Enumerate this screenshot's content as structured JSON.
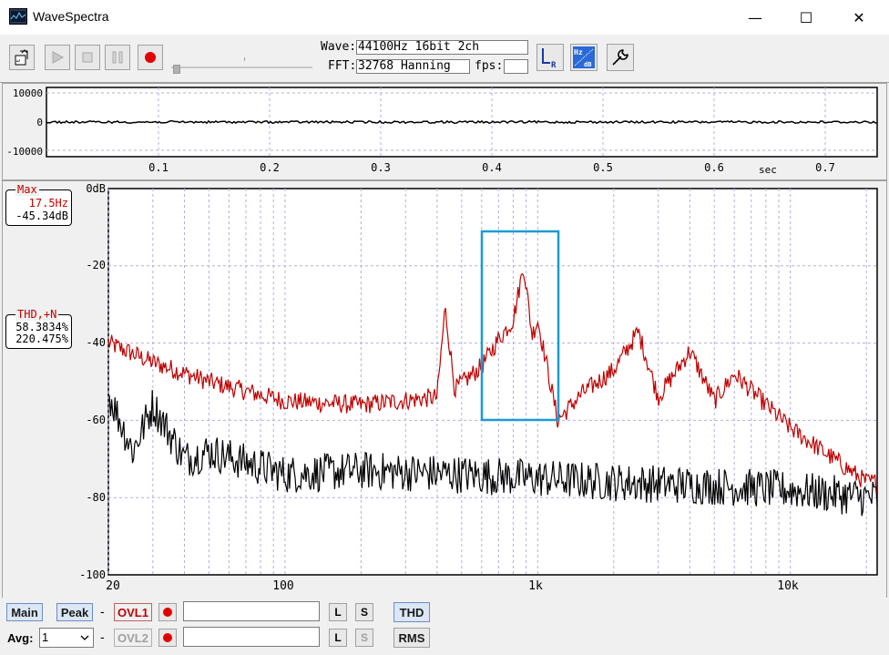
{
  "window": {
    "title": "WaveSpectra",
    "minimize": "—",
    "maximize": "☐",
    "close": "✕"
  },
  "toolbar": {
    "wave_label": "Wave:",
    "wave_value": "44100Hz 16bit 2ch",
    "fft_label": "FFT:",
    "fft_value": "32768 Hanning",
    "fps_label": "fps:",
    "fps_value": "",
    "lr_icon": "L R",
    "hzdb_icon": "Hz dB"
  },
  "wave_chart": {
    "y_ticks": [
      "10000",
      "0",
      "-10000"
    ],
    "x_ticks": [
      "0.1",
      "0.2",
      "0.3",
      "0.4",
      "0.5",
      "0.6",
      "0.7"
    ],
    "x_unit": "sec"
  },
  "spectrum": {
    "y_ticks": [
      "0dB",
      "-20",
      "-40",
      "-60",
      "-80",
      "-100"
    ],
    "x_ticks": [
      "20",
      "100",
      "1k",
      "10k"
    ],
    "colors": {
      "left": "#c00000",
      "right": "#000000",
      "highlight": "#1a9ad6",
      "grid": "#b0b0e0"
    }
  },
  "max_box": {
    "title": "Max",
    "freq": "17.5Hz",
    "level": "-45.34dB"
  },
  "thd_box": {
    "title": "THD,+N",
    "value1": "58.3834%",
    "value2": "220.475%"
  },
  "bottom": {
    "main": "Main",
    "peak": "Peak",
    "dash1": "-",
    "dash2": "-",
    "ovl1": "OVL1",
    "ovl2": "OVL2",
    "l": "L",
    "s": "S",
    "thd": "THD",
    "rms": "RMS",
    "avg_label": "Avg:",
    "avg_value": "1"
  },
  "chart_data": {
    "type": "line",
    "xscale": "log",
    "xlim": [
      20,
      22050
    ],
    "ylim": [
      -100,
      0
    ],
    "ylabel": "dB",
    "series": [
      {
        "color": "#c00000",
        "points": [
          [
            20,
            -40
          ],
          [
            30,
            -45
          ],
          [
            50,
            -50
          ],
          [
            100,
            -55
          ],
          [
            200,
            -56
          ],
          [
            400,
            -54
          ],
          [
            430,
            -31
          ],
          [
            470,
            -52
          ],
          [
            600,
            -46
          ],
          [
            700,
            -39
          ],
          [
            800,
            -34
          ],
          [
            880,
            -20
          ],
          [
            950,
            -38
          ],
          [
            1000,
            -34
          ],
          [
            1200,
            -60
          ],
          [
            1500,
            -53
          ],
          [
            2000,
            -47
          ],
          [
            2500,
            -37
          ],
          [
            3000,
            -54
          ],
          [
            4000,
            -42
          ],
          [
            5000,
            -55
          ],
          [
            6000,
            -48
          ],
          [
            10000,
            -62
          ],
          [
            20000,
            -76
          ]
        ]
      },
      {
        "color": "#000000",
        "points": [
          [
            20,
            -53
          ],
          [
            25,
            -68
          ],
          [
            30,
            -56
          ],
          [
            40,
            -70
          ],
          [
            50,
            -68
          ],
          [
            100,
            -74
          ],
          [
            200,
            -73
          ],
          [
            500,
            -74
          ],
          [
            1000,
            -75
          ],
          [
            2000,
            -76
          ],
          [
            5000,
            -77
          ],
          [
            10000,
            -78
          ],
          [
            20000,
            -80
          ]
        ]
      }
    ]
  }
}
